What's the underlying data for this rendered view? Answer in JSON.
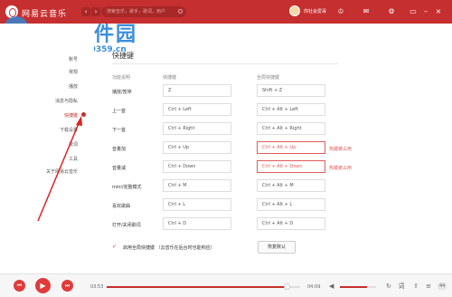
{
  "topbar": {
    "app_title": "网易云音乐",
    "back_icon": "‹",
    "forward_icon": "›",
    "search_placeholder": "搜索音乐，歌手，歌词，用户",
    "username": "你社会爱哥",
    "icons": [
      "shirt-icon",
      "mail-icon",
      "settings-icon"
    ]
  },
  "watermark": {
    "text": "河东软件园",
    "url": "www.pc0359.cn"
  },
  "sidebar": {
    "items": [
      {
        "label": "账号"
      },
      {
        "label": "常规"
      },
      {
        "label": "播放"
      },
      {
        "label": "消息与隐私"
      },
      {
        "label": "快捷键",
        "active": true
      },
      {
        "label": "下载设置"
      },
      {
        "label": "歌词"
      },
      {
        "label": "工具"
      },
      {
        "label": "关于网易云音乐"
      }
    ]
  },
  "content": {
    "section_title": "快捷键",
    "columns": [
      "功能说明",
      "快捷键",
      "全局快捷键"
    ],
    "rows": [
      {
        "label": "播放/暂停",
        "key": "Z",
        "global": "Shift + Z",
        "conflict": false
      },
      {
        "label": "上一首",
        "key": "Ctrl + Left",
        "global": "Ctrl + Alt + Left",
        "conflict": false
      },
      {
        "label": "下一首",
        "key": "Ctrl + Right",
        "global": "Ctrl + Alt + Right",
        "conflict": false
      },
      {
        "label": "音量加",
        "key": "Ctrl + Up",
        "global": "Ctrl + Alt + Up",
        "conflict": true
      },
      {
        "label": "音量减",
        "key": "Ctrl + Down",
        "global": "Ctrl + Alt + Down",
        "conflict": true
      },
      {
        "label": "mini/完整模式",
        "key": "Ctrl + M",
        "global": "Ctrl + Alt + M",
        "conflict": false
      },
      {
        "label": "喜欢歌曲",
        "key": "Ctrl + L",
        "global": "Ctrl + Alt + L",
        "conflict": false
      },
      {
        "label": "打开/关闭歌词",
        "key": "Ctrl + D",
        "global": "Ctrl + Alt + D",
        "conflict": false
      }
    ],
    "conflict_note": "热键被占用",
    "checkbox_label": "启用全局快捷键 （云音乐在后台时也能响应）",
    "checkbox_checked": true,
    "reset_label": "恢复默认"
  },
  "player": {
    "current_time": "03:53",
    "total_time": "04:09",
    "progress": 0.93,
    "volume": 0.75,
    "playlist_count": "44",
    "accent_color": "#c62f2f"
  }
}
